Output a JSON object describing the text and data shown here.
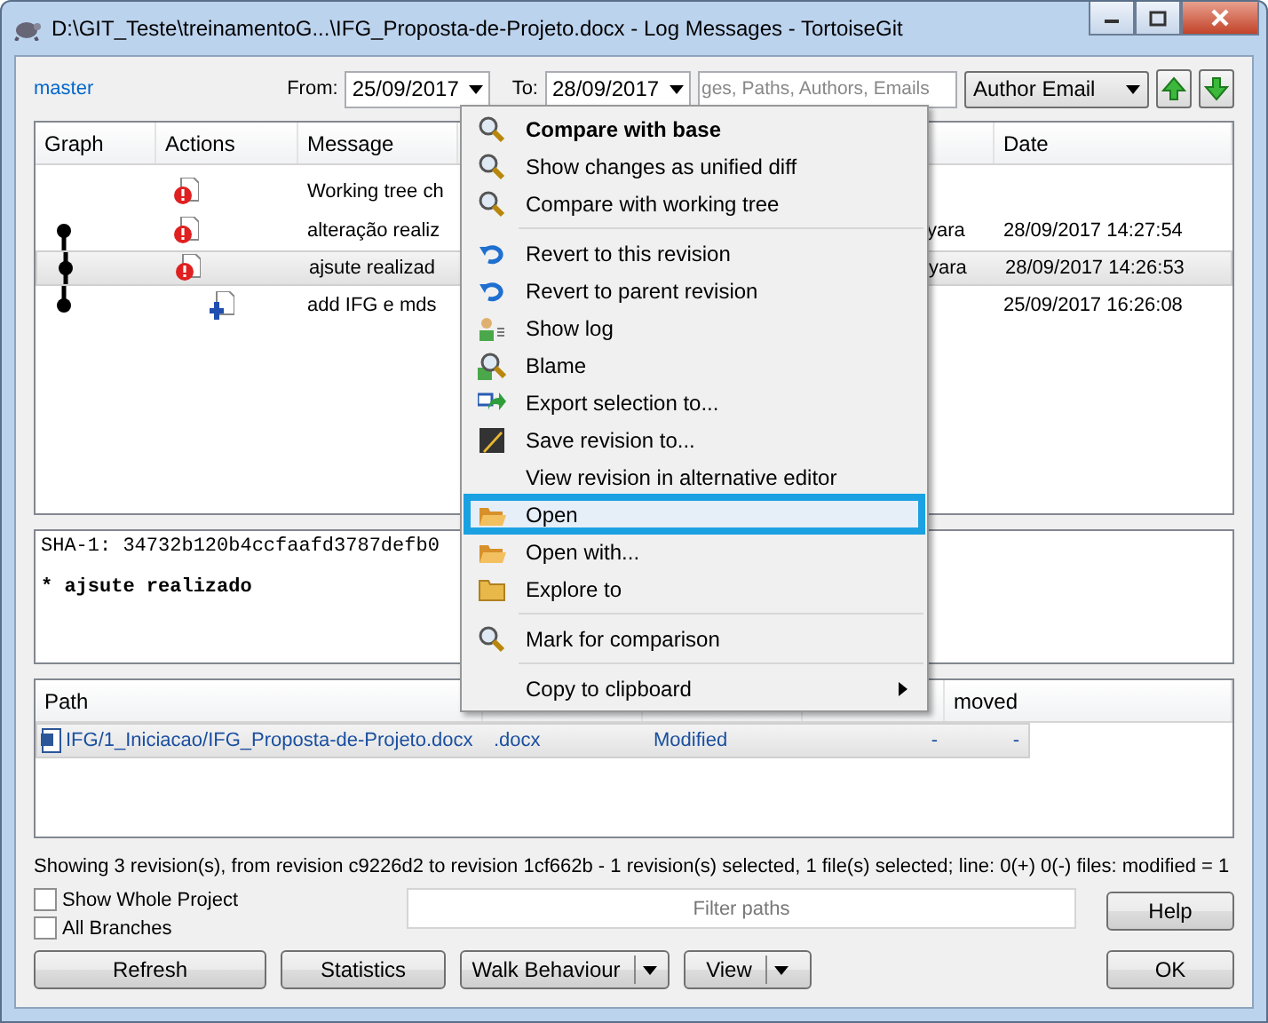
{
  "window": {
    "title": "D:\\GIT_Teste\\treinamentoG...\\IFG_Proposta-de-Projeto.docx - Log Messages - TortoiseGit"
  },
  "toolbar": {
    "branch": "master",
    "from_label": "From:",
    "from_date": "25/09/2017",
    "to_label": "To:",
    "to_date": "28/09/2017",
    "search_placeholder": "ges, Paths, Authors, Emails",
    "filter_select": "Author Email"
  },
  "log": {
    "columns": [
      "Graph",
      "Actions",
      "Message",
      "Date"
    ],
    "rows": [
      {
        "kind": "modified",
        "message": "Working tree ch",
        "selected": false
      },
      {
        "kind": "modified",
        "message": "alteração realiz",
        "author": "yara",
        "date": "28/09/2017 14:27:54",
        "selected": false
      },
      {
        "kind": "modified",
        "message": "ajsute realizad",
        "author": "yara",
        "date": "28/09/2017 14:26:53",
        "selected": true
      },
      {
        "kind": "added",
        "message": "add IFG e mds",
        "date": "25/09/2017 16:26:08",
        "selected": false
      }
    ]
  },
  "message_panel": {
    "sha": "SHA-1: 34732b120b4ccfaafd3787defb0",
    "text": "* ajsute realizado"
  },
  "files": {
    "columns": [
      "Path",
      "moved"
    ],
    "rows": [
      {
        "path": "IFG/1_Iniciacao/IFG_Proposta-de-Projeto.docx",
        "ext": ".docx",
        "status": "Modified",
        "added": "-",
        "removed": "-",
        "selected": true
      }
    ]
  },
  "status_bar": "Showing 3 revision(s), from revision c9226d2 to revision 1cf662b - 1 revision(s) selected, 1 file(s) selected; line: 0(+) 0(-) files: modified = 1",
  "checkboxes": [
    {
      "label": "Show Whole Project",
      "checked": false
    },
    {
      "label": "All Branches",
      "checked": false
    }
  ],
  "filter_placeholder": "Filter paths",
  "buttons": {
    "help": "Help",
    "refresh": "Refresh",
    "statistics": "Statistics",
    "walk": "Walk Behaviour",
    "view": "View",
    "ok": "OK"
  },
  "context_menu": [
    {
      "kind": "item",
      "label": "Compare with base",
      "bold": true,
      "selected": false
    },
    {
      "kind": "item",
      "label": "Show changes as unified diff",
      "bold": false,
      "selected": false
    },
    {
      "kind": "item",
      "label": "Compare with working tree",
      "bold": false,
      "selected": false
    },
    {
      "kind": "separator"
    },
    {
      "kind": "item",
      "label": "Revert to this revision",
      "bold": false,
      "selected": false
    },
    {
      "kind": "item",
      "label": "Revert to parent revision",
      "bold": false,
      "selected": false
    },
    {
      "kind": "item",
      "label": "Show log",
      "bold": false,
      "selected": false
    },
    {
      "kind": "item",
      "label": "Blame",
      "bold": false,
      "selected": false
    },
    {
      "kind": "item",
      "label": "Export selection to...",
      "bold": false,
      "selected": false
    },
    {
      "kind": "item",
      "label": "Save revision to...",
      "bold": false,
      "selected": false
    },
    {
      "kind": "item",
      "label": "View revision in alternative editor",
      "bold": false,
      "selected": false
    },
    {
      "kind": "item",
      "label": "Open",
      "bold": false,
      "selected": true
    },
    {
      "kind": "item",
      "label": "Open with...",
      "bold": false,
      "selected": false
    },
    {
      "kind": "item",
      "label": "Explore to",
      "bold": false,
      "selected": false
    },
    {
      "kind": "separator"
    },
    {
      "kind": "item",
      "label": "Mark for comparison",
      "bold": false,
      "selected": false
    },
    {
      "kind": "separator"
    },
    {
      "kind": "submenu",
      "label": "Copy to clipboard",
      "bold": false,
      "selected": false
    }
  ]
}
